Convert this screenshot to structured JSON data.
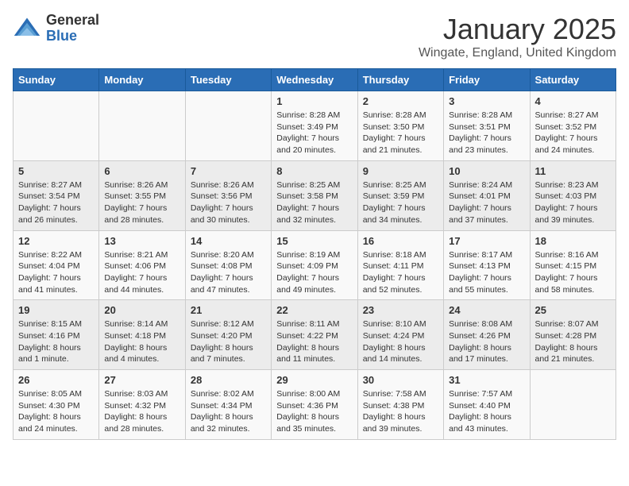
{
  "logo": {
    "general": "General",
    "blue": "Blue"
  },
  "title": {
    "month": "January 2025",
    "location": "Wingate, England, United Kingdom"
  },
  "weekdays": [
    "Sunday",
    "Monday",
    "Tuesday",
    "Wednesday",
    "Thursday",
    "Friday",
    "Saturday"
  ],
  "weeks": [
    [
      {
        "day": "",
        "info": ""
      },
      {
        "day": "",
        "info": ""
      },
      {
        "day": "",
        "info": ""
      },
      {
        "day": "1",
        "info": "Sunrise: 8:28 AM\nSunset: 3:49 PM\nDaylight: 7 hours\nand 20 minutes."
      },
      {
        "day": "2",
        "info": "Sunrise: 8:28 AM\nSunset: 3:50 PM\nDaylight: 7 hours\nand 21 minutes."
      },
      {
        "day": "3",
        "info": "Sunrise: 8:28 AM\nSunset: 3:51 PM\nDaylight: 7 hours\nand 23 minutes."
      },
      {
        "day": "4",
        "info": "Sunrise: 8:27 AM\nSunset: 3:52 PM\nDaylight: 7 hours\nand 24 minutes."
      }
    ],
    [
      {
        "day": "5",
        "info": "Sunrise: 8:27 AM\nSunset: 3:54 PM\nDaylight: 7 hours\nand 26 minutes."
      },
      {
        "day": "6",
        "info": "Sunrise: 8:26 AM\nSunset: 3:55 PM\nDaylight: 7 hours\nand 28 minutes."
      },
      {
        "day": "7",
        "info": "Sunrise: 8:26 AM\nSunset: 3:56 PM\nDaylight: 7 hours\nand 30 minutes."
      },
      {
        "day": "8",
        "info": "Sunrise: 8:25 AM\nSunset: 3:58 PM\nDaylight: 7 hours\nand 32 minutes."
      },
      {
        "day": "9",
        "info": "Sunrise: 8:25 AM\nSunset: 3:59 PM\nDaylight: 7 hours\nand 34 minutes."
      },
      {
        "day": "10",
        "info": "Sunrise: 8:24 AM\nSunset: 4:01 PM\nDaylight: 7 hours\nand 37 minutes."
      },
      {
        "day": "11",
        "info": "Sunrise: 8:23 AM\nSunset: 4:03 PM\nDaylight: 7 hours\nand 39 minutes."
      }
    ],
    [
      {
        "day": "12",
        "info": "Sunrise: 8:22 AM\nSunset: 4:04 PM\nDaylight: 7 hours\nand 41 minutes."
      },
      {
        "day": "13",
        "info": "Sunrise: 8:21 AM\nSunset: 4:06 PM\nDaylight: 7 hours\nand 44 minutes."
      },
      {
        "day": "14",
        "info": "Sunrise: 8:20 AM\nSunset: 4:08 PM\nDaylight: 7 hours\nand 47 minutes."
      },
      {
        "day": "15",
        "info": "Sunrise: 8:19 AM\nSunset: 4:09 PM\nDaylight: 7 hours\nand 49 minutes."
      },
      {
        "day": "16",
        "info": "Sunrise: 8:18 AM\nSunset: 4:11 PM\nDaylight: 7 hours\nand 52 minutes."
      },
      {
        "day": "17",
        "info": "Sunrise: 8:17 AM\nSunset: 4:13 PM\nDaylight: 7 hours\nand 55 minutes."
      },
      {
        "day": "18",
        "info": "Sunrise: 8:16 AM\nSunset: 4:15 PM\nDaylight: 7 hours\nand 58 minutes."
      }
    ],
    [
      {
        "day": "19",
        "info": "Sunrise: 8:15 AM\nSunset: 4:16 PM\nDaylight: 8 hours\nand 1 minute."
      },
      {
        "day": "20",
        "info": "Sunrise: 8:14 AM\nSunset: 4:18 PM\nDaylight: 8 hours\nand 4 minutes."
      },
      {
        "day": "21",
        "info": "Sunrise: 8:12 AM\nSunset: 4:20 PM\nDaylight: 8 hours\nand 7 minutes."
      },
      {
        "day": "22",
        "info": "Sunrise: 8:11 AM\nSunset: 4:22 PM\nDaylight: 8 hours\nand 11 minutes."
      },
      {
        "day": "23",
        "info": "Sunrise: 8:10 AM\nSunset: 4:24 PM\nDaylight: 8 hours\nand 14 minutes."
      },
      {
        "day": "24",
        "info": "Sunrise: 8:08 AM\nSunset: 4:26 PM\nDaylight: 8 hours\nand 17 minutes."
      },
      {
        "day": "25",
        "info": "Sunrise: 8:07 AM\nSunset: 4:28 PM\nDaylight: 8 hours\nand 21 minutes."
      }
    ],
    [
      {
        "day": "26",
        "info": "Sunrise: 8:05 AM\nSunset: 4:30 PM\nDaylight: 8 hours\nand 24 minutes."
      },
      {
        "day": "27",
        "info": "Sunrise: 8:03 AM\nSunset: 4:32 PM\nDaylight: 8 hours\nand 28 minutes."
      },
      {
        "day": "28",
        "info": "Sunrise: 8:02 AM\nSunset: 4:34 PM\nDaylight: 8 hours\nand 32 minutes."
      },
      {
        "day": "29",
        "info": "Sunrise: 8:00 AM\nSunset: 4:36 PM\nDaylight: 8 hours\nand 35 minutes."
      },
      {
        "day": "30",
        "info": "Sunrise: 7:58 AM\nSunset: 4:38 PM\nDaylight: 8 hours\nand 39 minutes."
      },
      {
        "day": "31",
        "info": "Sunrise: 7:57 AM\nSunset: 4:40 PM\nDaylight: 8 hours\nand 43 minutes."
      },
      {
        "day": "",
        "info": ""
      }
    ]
  ]
}
